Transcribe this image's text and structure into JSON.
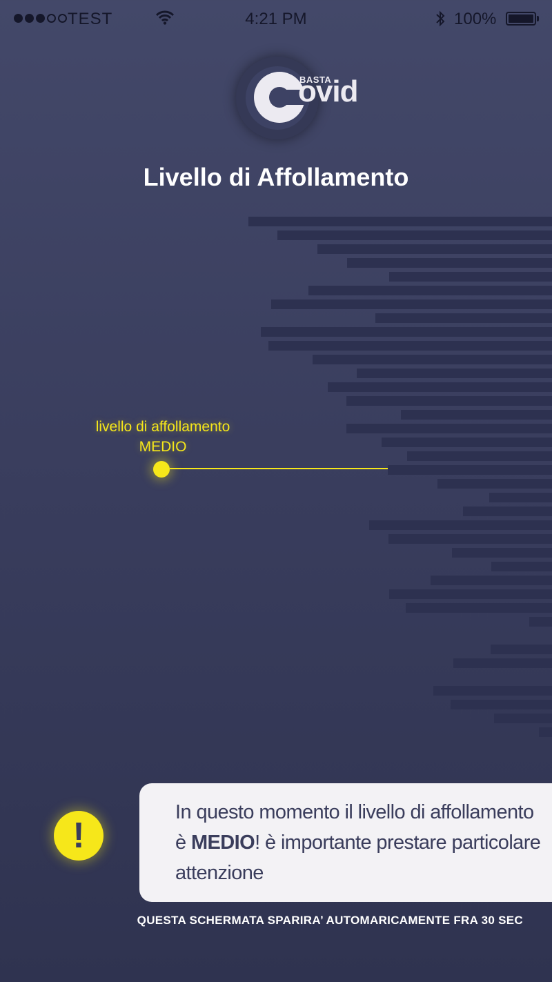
{
  "status_bar": {
    "carrier": "TEST",
    "time": "4:21 PM",
    "battery": "100%",
    "signal_bars": 3,
    "signal_total": 5
  },
  "logo": {
    "small": "BASTA",
    "big": "ovid"
  },
  "title": "Livello di Affollamento",
  "level": {
    "caption_line1": "livello di affollamento",
    "caption_line2": "MEDIO"
  },
  "alert": {
    "line1": "In questo momento il livello di affollamento",
    "line2_prefix": "è ",
    "line2_bold": "MEDIO",
    "line2_suffix": "! è importante prestare particolare",
    "line3": "attenzione",
    "icon": "exclamation-icon"
  },
  "footer": "QUESTA SCHERMATA SPARIRA’ AUTOMARICAMENTE FRA 30 SEC",
  "colors": {
    "background": "#3e4264",
    "accent_yellow": "#f6e71a",
    "panel": "#f3f2f5"
  }
}
